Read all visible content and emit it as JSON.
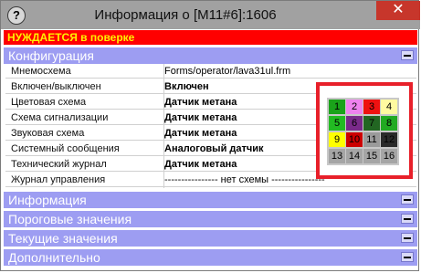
{
  "window": {
    "title": "Информация о [M11#6]:1606",
    "help_label": "?",
    "close_label": "✕"
  },
  "alert_text": "НУЖДАЕТСЯ в поверке",
  "sections": {
    "config": "Конфигурация",
    "info": "Информация",
    "thresholds": "Пороговые значения",
    "current": "Текущие значения",
    "extra": "Дополнительно"
  },
  "config_rows": [
    {
      "key": "Мнемосхема",
      "value": "Forms/operator/lava31ul.frm"
    },
    {
      "key": "Включен/выключен",
      "value": "Включен"
    },
    {
      "key": "Цветовая схема",
      "value": "Датчик метана"
    },
    {
      "key": "Схема сигнализации",
      "value": "Датчик метана"
    },
    {
      "key": "Звуковая схема",
      "value": "Датчик метана"
    },
    {
      "key": "Системный сообщения",
      "value": "Аналоговый датчик"
    },
    {
      "key": "Технический журнал",
      "value": "Датчик метана"
    },
    {
      "key": "Журнал управления",
      "value": "---------------- нет схемы ----------------"
    }
  ],
  "color_grid": [
    {
      "n": "1",
      "bg": "#1aa31a"
    },
    {
      "n": "2",
      "bg": "#ee82ee"
    },
    {
      "n": "3",
      "bg": "#ee1111"
    },
    {
      "n": "4",
      "bg": "#fffaa0"
    },
    {
      "n": "5",
      "bg": "#22bb22"
    },
    {
      "n": "6",
      "bg": "#7a2a8a"
    },
    {
      "n": "7",
      "bg": "#226622"
    },
    {
      "n": "8",
      "bg": "#22aa22"
    },
    {
      "n": "9",
      "bg": "#ffff00"
    },
    {
      "n": "10",
      "bg": "#cc0000"
    },
    {
      "n": "11",
      "bg": "#9a9a9a"
    },
    {
      "n": "12",
      "bg": "#2a2a2a"
    },
    {
      "n": "13",
      "bg": "#a5a5a5"
    },
    {
      "n": "14",
      "bg": "#a5a5a5"
    },
    {
      "n": "15",
      "bg": "#a5a5a5"
    },
    {
      "n": "16",
      "bg": "#a5a5a5"
    }
  ],
  "colors": {
    "alert_bg": "#ff0000",
    "alert_text": "#fff200",
    "section_bg": "#9d9df2",
    "close_bg": "#c7362b",
    "highlight_frame": "#e8202a"
  }
}
